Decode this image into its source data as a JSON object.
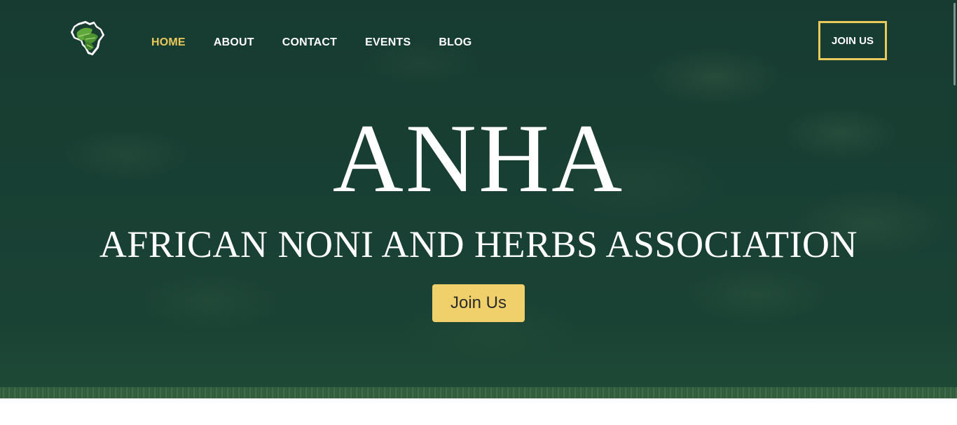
{
  "nav": {
    "items": [
      {
        "label": "HOME",
        "active": true
      },
      {
        "label": "ABOUT",
        "active": false
      },
      {
        "label": "CONTACT",
        "active": false
      },
      {
        "label": "EVENTS",
        "active": false
      },
      {
        "label": "BLOG",
        "active": false
      }
    ],
    "join_label": "JOIN US"
  },
  "hero": {
    "title": "ANHA",
    "subtitle": "AFRICAN NONI AND HERBS ASSOCIATION",
    "cta_label": "Join Us"
  },
  "colors": {
    "accent": "#e9c95c",
    "cta_background": "#efd06a",
    "hero_background": "#183f33"
  },
  "icons": {
    "logo": "africa-leaf-logo"
  }
}
